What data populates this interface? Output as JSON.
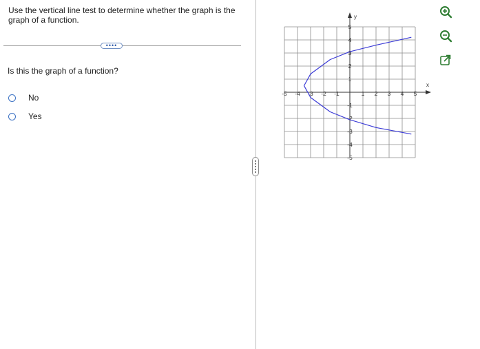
{
  "question": {
    "instruction": "Use the vertical line test to determine whether the graph is the graph of a function.",
    "more_label": "••••",
    "prompt": "Is this the graph of a function?",
    "options": [
      {
        "label": "No",
        "selected": false
      },
      {
        "label": "Yes",
        "selected": false
      }
    ]
  },
  "graph": {
    "x_axis_label": "x",
    "y_axis_label": "y",
    "x_tick_labels": [
      "-5",
      "-4",
      "-3",
      "-2",
      "-1",
      "1",
      "2",
      "3",
      "4",
      "5"
    ],
    "y_tick_labels": [
      "5",
      "4",
      "3",
      "2",
      "1",
      "-1",
      "-2",
      "-3",
      "-4",
      "-5"
    ],
    "curve_color": "#3b3bd6",
    "grid_color": "#8c8c8c"
  },
  "chart_data": {
    "type": "line",
    "xlim": [
      -5,
      5
    ],
    "ylim": [
      -5,
      5
    ],
    "grid": true,
    "xlabel": "x",
    "ylabel": "y",
    "series": [
      {
        "x": [
          4.7,
          2,
          0,
          -1.5,
          -3,
          -3.5,
          -3,
          -1.5,
          0,
          2,
          4.7
        ],
        "y": [
          4.2,
          3.6,
          3.1,
          2.5,
          1.4,
          0.5,
          -0.4,
          -1.5,
          -2.1,
          -2.7,
          -3.2
        ]
      }
    ]
  },
  "toolbar": {
    "zoom_in_icon": "zoom-in-icon",
    "zoom_out_icon": "zoom-out-icon",
    "popout_icon": "popout-icon",
    "accent": "#2e7d32"
  }
}
